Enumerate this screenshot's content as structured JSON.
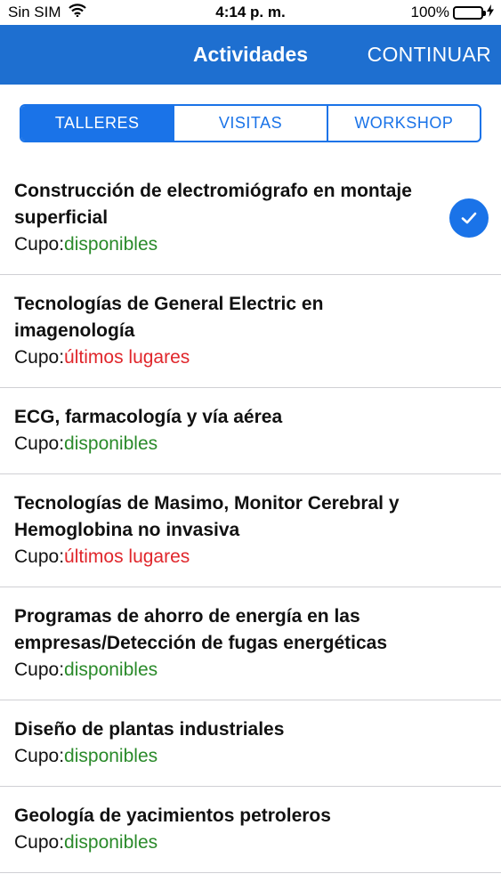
{
  "status_bar": {
    "carrier": "Sin SIM",
    "time": "4:14 p. m.",
    "battery": "100%",
    "battery_level": 1.0
  },
  "nav": {
    "title": "Actividades",
    "continue_label": "CONTINUAR"
  },
  "segments": [
    {
      "label": "TALLERES",
      "selected": true
    },
    {
      "label": "VISITAS",
      "selected": false
    },
    {
      "label": "WORKSHOP",
      "selected": false
    }
  ],
  "cupo_prefix": "Cupo:",
  "colors": {
    "nav_background": "#1e6fd0",
    "accent": "#1a73e8",
    "available": "#2a8a2a",
    "limited": "#e0262b"
  },
  "activities": [
    {
      "title": "Construcción de electromiógrafo en montaje superficial",
      "status": "disponibles",
      "status_kind": "available",
      "selected": true
    },
    {
      "title": "Tecnologías de General Electric en imagenología",
      "status": "últimos lugares",
      "status_kind": "limited",
      "selected": false
    },
    {
      "title": "ECG, farmacología y vía aérea",
      "status": "disponibles",
      "status_kind": "available",
      "selected": false
    },
    {
      "title": "Tecnologías de Masimo, Monitor Cerebral y Hemoglobina no invasiva",
      "status": "últimos lugares",
      "status_kind": "limited",
      "selected": false
    },
    {
      "title": "Programas de ahorro de energía en las empresas/Detección de fugas energéticas",
      "status": "disponibles",
      "status_kind": "available",
      "selected": false
    },
    {
      "title": "Diseño de plantas industriales",
      "status": "disponibles",
      "status_kind": "available",
      "selected": false
    },
    {
      "title": "Geología de yacimientos petroleros",
      "status": "disponibles",
      "status_kind": "available",
      "selected": false
    }
  ]
}
